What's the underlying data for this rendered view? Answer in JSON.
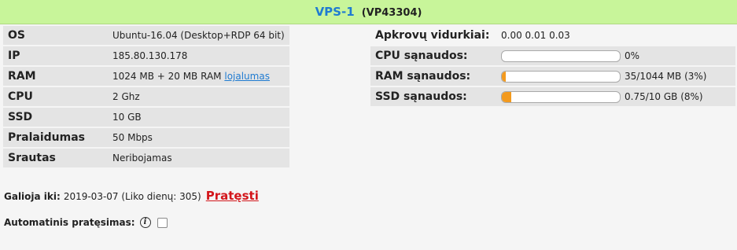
{
  "header": {
    "vps_name": "VPS-1",
    "vps_code": "(VP43304)"
  },
  "info": [
    {
      "key": "OS",
      "value": "Ubuntu-16.04 (Desktop+RDP 64 bit)"
    },
    {
      "key": "IP",
      "value": "185.80.130.178"
    },
    {
      "key": "RAM",
      "value": "1024 MB + 20 MB RAM",
      "link": "lojalumas"
    },
    {
      "key": "CPU",
      "value": "2 Ghz"
    },
    {
      "key": "SSD",
      "value": "10 GB"
    },
    {
      "key": "Pralaidumas",
      "value": "50 Mbps"
    },
    {
      "key": "Srautas",
      "value": "Neribojamas"
    }
  ],
  "stats": {
    "load": {
      "label": "Apkrovų vidurkiai:",
      "value": "0.00 0.01 0.03"
    },
    "cpu": {
      "label": "CPU sąnaudos:",
      "value": "0%",
      "fraction": 0.0
    },
    "ram": {
      "label": "RAM sąnaudos:",
      "value": "35/1044 MB (3%)",
      "fraction": 0.03
    },
    "ssd": {
      "label": "SSD sąnaudos:",
      "value": "0.75/10 GB (8%)",
      "fraction": 0.08
    }
  },
  "validity": {
    "label": "Galioja iki:",
    "value": "2019-03-07 (Liko dienų: 305)",
    "renew": "Pratęsti"
  },
  "auto_renew": {
    "label": "Automatinis pratęsimas:",
    "checked": false
  },
  "colors": {
    "header_bg": "#c8f59a",
    "accent": "#1f7bd1",
    "bar_fill": "#f39a1e",
    "renew": "#d3161b"
  },
  "icons": {
    "info": "info-icon"
  }
}
